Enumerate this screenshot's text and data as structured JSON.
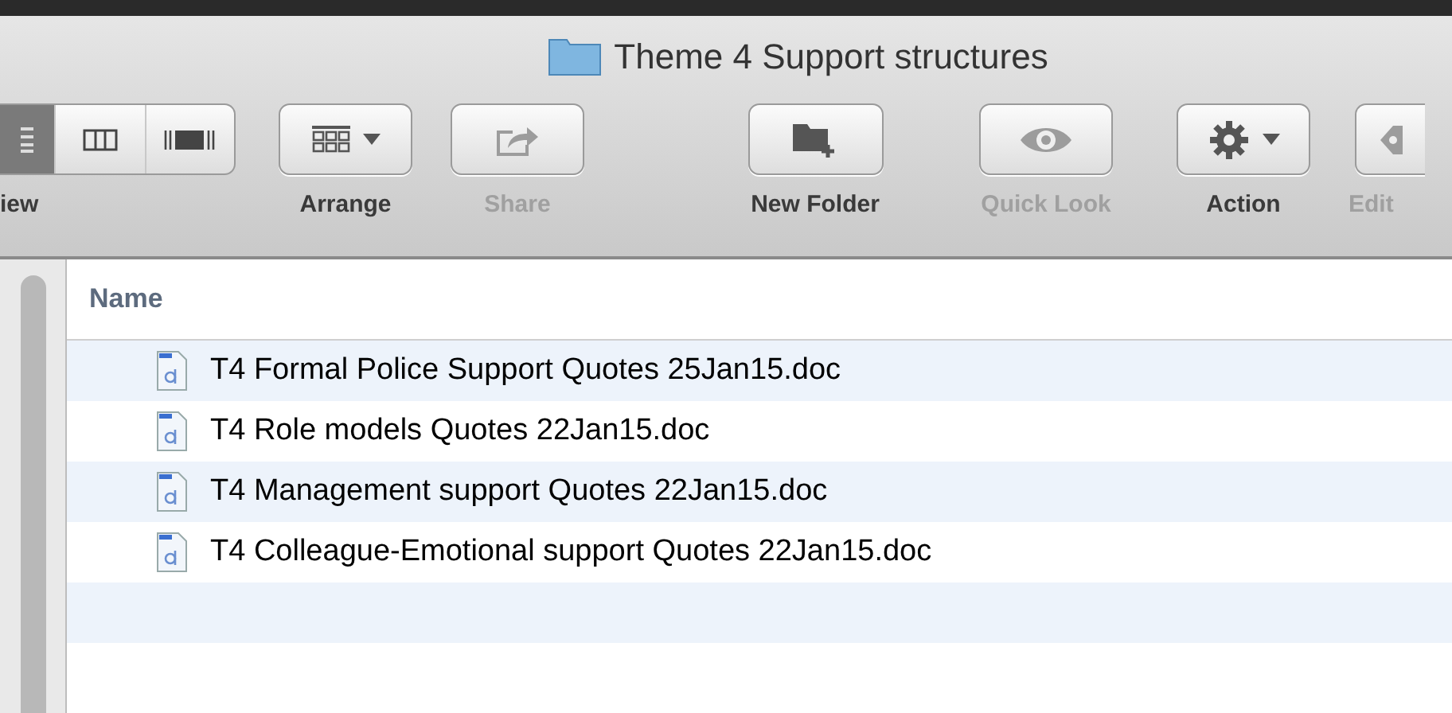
{
  "window": {
    "title": "Theme 4 Support structures"
  },
  "toolbar": {
    "items": [
      {
        "kind": "view",
        "label": "iew",
        "disabled": false,
        "segments": [
          {
            "selected": true
          },
          {
            "selected": false
          },
          {
            "selected": false
          }
        ]
      },
      {
        "kind": "arrange",
        "label": "Arrange",
        "disabled": false
      },
      {
        "kind": "share",
        "label": "Share",
        "disabled": true
      },
      {
        "kind": "new-folder",
        "label": "New Folder",
        "disabled": false
      },
      {
        "kind": "quick-look",
        "label": "Quick Look",
        "disabled": true
      },
      {
        "kind": "action",
        "label": "Action",
        "disabled": false
      },
      {
        "kind": "edit",
        "label": "Edit",
        "disabled": true
      }
    ]
  },
  "file_list": {
    "columns": [
      "Name"
    ],
    "rows": [
      {
        "name": "T4 Formal Police Support Quotes 25Jan15.doc"
      },
      {
        "name": "T4 Role models Quotes 22Jan15.doc"
      },
      {
        "name": "T4 Management support Quotes 22Jan15.doc"
      },
      {
        "name": "T4 Colleague-Emotional support Quotes 22Jan15.doc"
      }
    ]
  }
}
